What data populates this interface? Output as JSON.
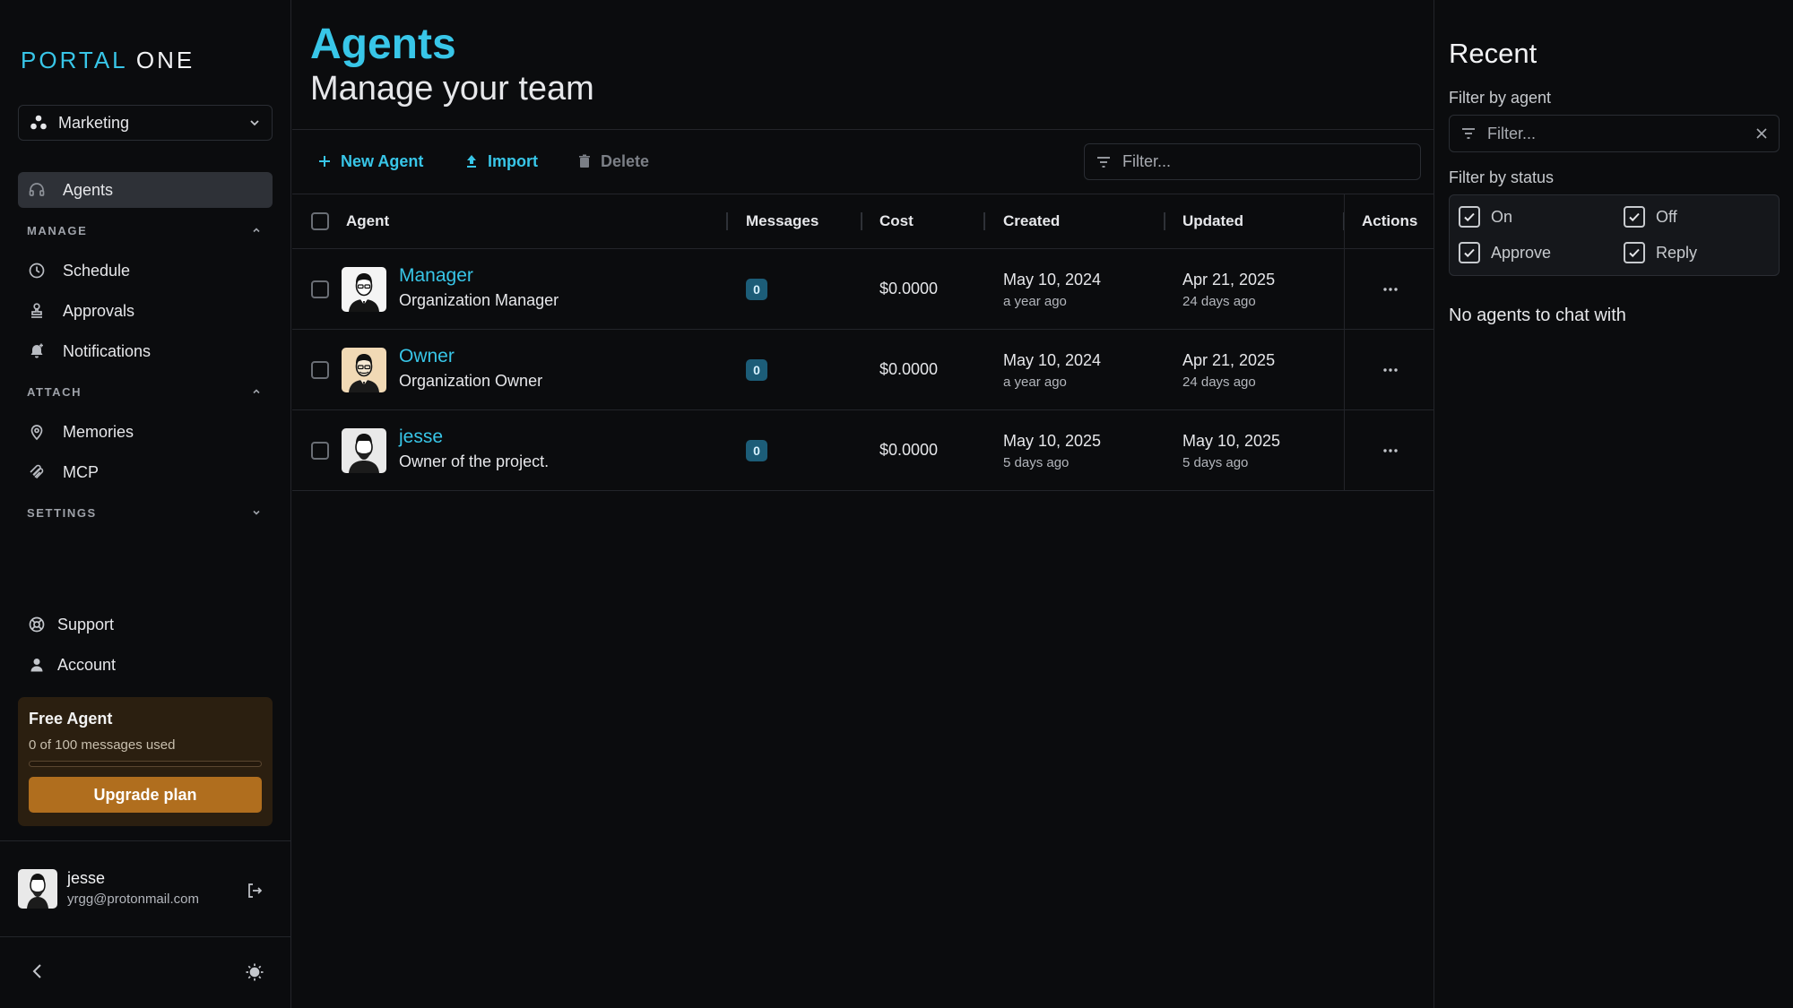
{
  "brand": {
    "part1": "PORTAL",
    "part2": "ONE"
  },
  "workspace": {
    "label": "Marketing"
  },
  "nav": {
    "agents": "Agents",
    "manage_header": "MANAGE",
    "schedule": "Schedule",
    "approvals": "Approvals",
    "notifications": "Notifications",
    "attach_header": "ATTACH",
    "memories": "Memories",
    "mcp": "MCP",
    "settings_header": "SETTINGS",
    "support": "Support",
    "account": "Account"
  },
  "plan": {
    "title": "Free Agent",
    "usage": "0 of 100 messages used",
    "used_fraction": 0,
    "upgrade_label": "Upgrade plan"
  },
  "user": {
    "name": "jesse",
    "email": "yrgg@protonmail.com"
  },
  "page": {
    "title": "Agents",
    "subtitle": "Manage your team"
  },
  "toolbar": {
    "new_agent": "New Agent",
    "import": "Import",
    "delete": "Delete",
    "filter_placeholder": "Filter..."
  },
  "table": {
    "headers": {
      "agent": "Agent",
      "messages": "Messages",
      "cost": "Cost",
      "created": "Created",
      "updated": "Updated",
      "actions": "Actions"
    },
    "rows": [
      {
        "name": "Manager",
        "description": "Organization Manager",
        "messages": "0",
        "cost": "$0.0000",
        "created": "May 10, 2024",
        "created_rel": "a year ago",
        "updated": "Apr 21, 2025",
        "updated_rel": "24 days ago"
      },
      {
        "name": "Owner",
        "description": "Organization Owner",
        "messages": "0",
        "cost": "$0.0000",
        "created": "May 10, 2024",
        "created_rel": "a year ago",
        "updated": "Apr 21, 2025",
        "updated_rel": "24 days ago"
      },
      {
        "name": "jesse",
        "description": "Owner of the project.",
        "messages": "0",
        "cost": "$0.0000",
        "created": "May 10, 2025",
        "created_rel": "5 days ago",
        "updated": "May 10, 2025",
        "updated_rel": "5 days ago"
      }
    ]
  },
  "recent": {
    "title": "Recent",
    "filter_agent_label": "Filter by agent",
    "filter_placeholder": "Filter...",
    "filter_status_label": "Filter by status",
    "statuses": [
      {
        "label": "On",
        "checked": true
      },
      {
        "label": "Off",
        "checked": true
      },
      {
        "label": "Approve",
        "checked": true
      },
      {
        "label": "Reply",
        "checked": true
      }
    ],
    "empty": "No agents to chat with"
  },
  "colors": {
    "accent": "#38c6e8",
    "plan_bg": "#2b1f10",
    "plan_button": "#b06e1e",
    "badge": "#1c5d78"
  }
}
